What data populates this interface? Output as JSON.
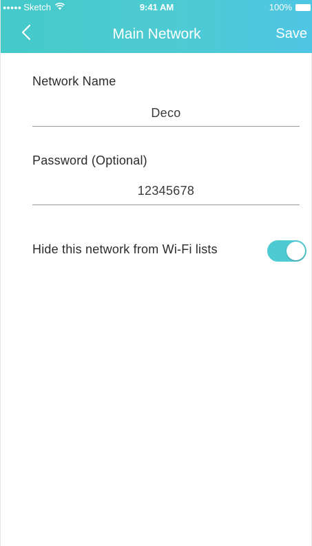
{
  "status_bar": {
    "signal_dots": "●●●●●",
    "carrier": "Sketch",
    "time": "9:41 AM",
    "battery": "100%"
  },
  "nav": {
    "back_icon": "chevron-left-icon",
    "title": "Main Network",
    "save_label": "Save"
  },
  "form": {
    "network_name": {
      "label": "Network Name",
      "value": "Deco"
    },
    "password": {
      "label": "Password (Optional)",
      "value": "12345678"
    },
    "hide_network": {
      "label": "Hide this network from Wi-Fi lists",
      "enabled": true
    }
  },
  "colors": {
    "accent": "#4ecbd2",
    "header_start": "#45c9c9",
    "header_end": "#4fc6e4"
  }
}
